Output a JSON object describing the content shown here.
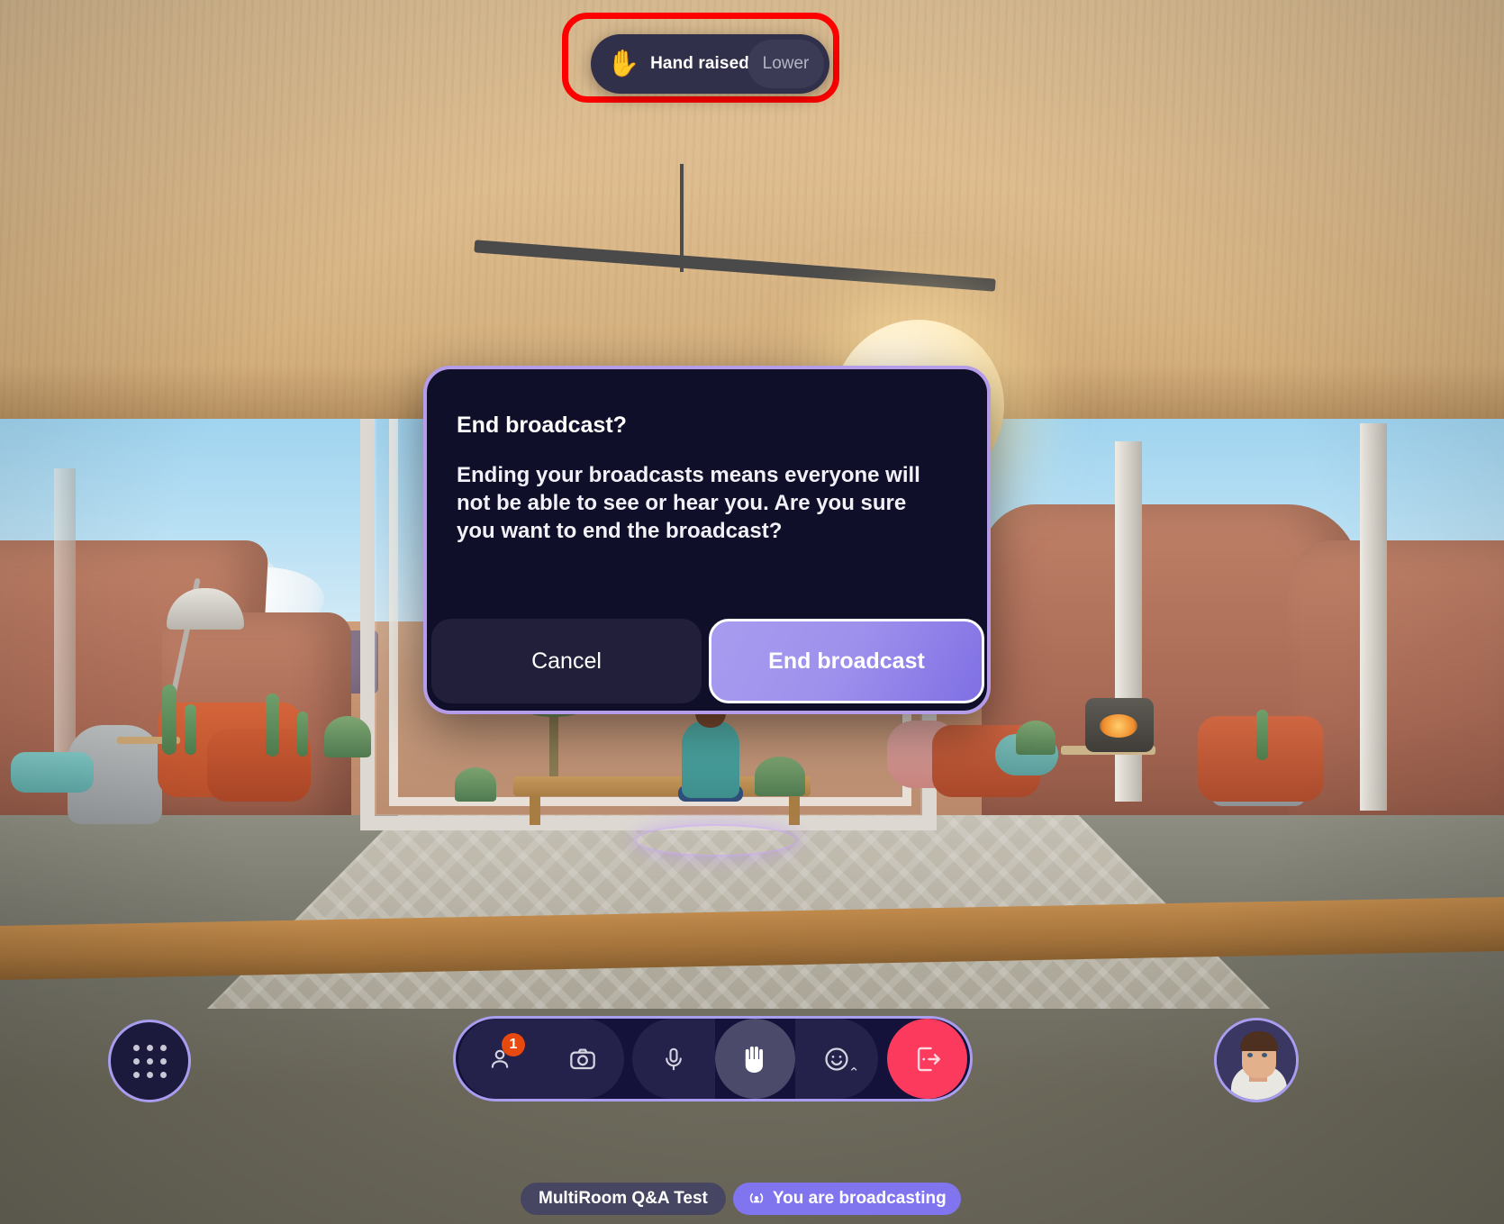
{
  "scene": {
    "description": "Virtual reality meeting room with desert landscape view"
  },
  "hand_toast": {
    "icon": "raised-hand-icon",
    "emoji": "✋",
    "label": "Hand raised",
    "lower_button": "Lower",
    "highlight_color": "#fe0000",
    "background_color": "#31304a"
  },
  "modal": {
    "title": "End broadcast?",
    "body": "Ending your broadcasts means everyone will not be able to see or hear you. Are you sure you want to end the broadcast?",
    "cancel_label": "Cancel",
    "confirm_label": "End broadcast",
    "border_color": "#b49ce8",
    "background_color": "#100f2a",
    "confirm_color": "#9d90ec"
  },
  "toolbar": {
    "apps_button": {
      "icon": "apps-grid-icon",
      "label": ""
    },
    "buttons": [
      {
        "name": "people",
        "icon": "person-icon",
        "badge": "1"
      },
      {
        "name": "camera",
        "icon": "camera-icon",
        "badge": ""
      },
      {
        "name": "microphone",
        "icon": "microphone-icon",
        "badge": ""
      },
      {
        "name": "raise-hand",
        "icon": "hand-icon",
        "badge": "",
        "active": true
      },
      {
        "name": "reactions",
        "icon": "smiley-icon",
        "badge": "",
        "caret": "⌃"
      },
      {
        "name": "leave",
        "icon": "exit-door-icon",
        "badge": ""
      }
    ],
    "accent_color": "#a99df0",
    "leave_color": "#fb3a5d",
    "badge_color": "#e8490f"
  },
  "status_chips": {
    "room_name": "MultiRoom Q&A Test",
    "broadcast_icon": "broadcast-icon",
    "broadcast_text": "You are broadcasting",
    "broadcast_color": "#8074ef"
  },
  "self_avatar": {
    "label": "self-avatar",
    "border_color": "#a99df0"
  }
}
